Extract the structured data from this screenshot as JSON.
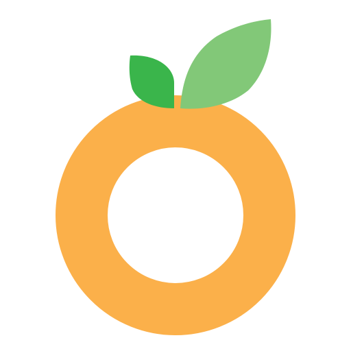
{
  "logo": {
    "icon": "orange-fruit-logo-icon",
    "colors": {
      "background": "#ffffff",
      "ring": "#FBB04A",
      "leaf_dark": "#3AB54B",
      "leaf_light": "#82C878"
    }
  }
}
